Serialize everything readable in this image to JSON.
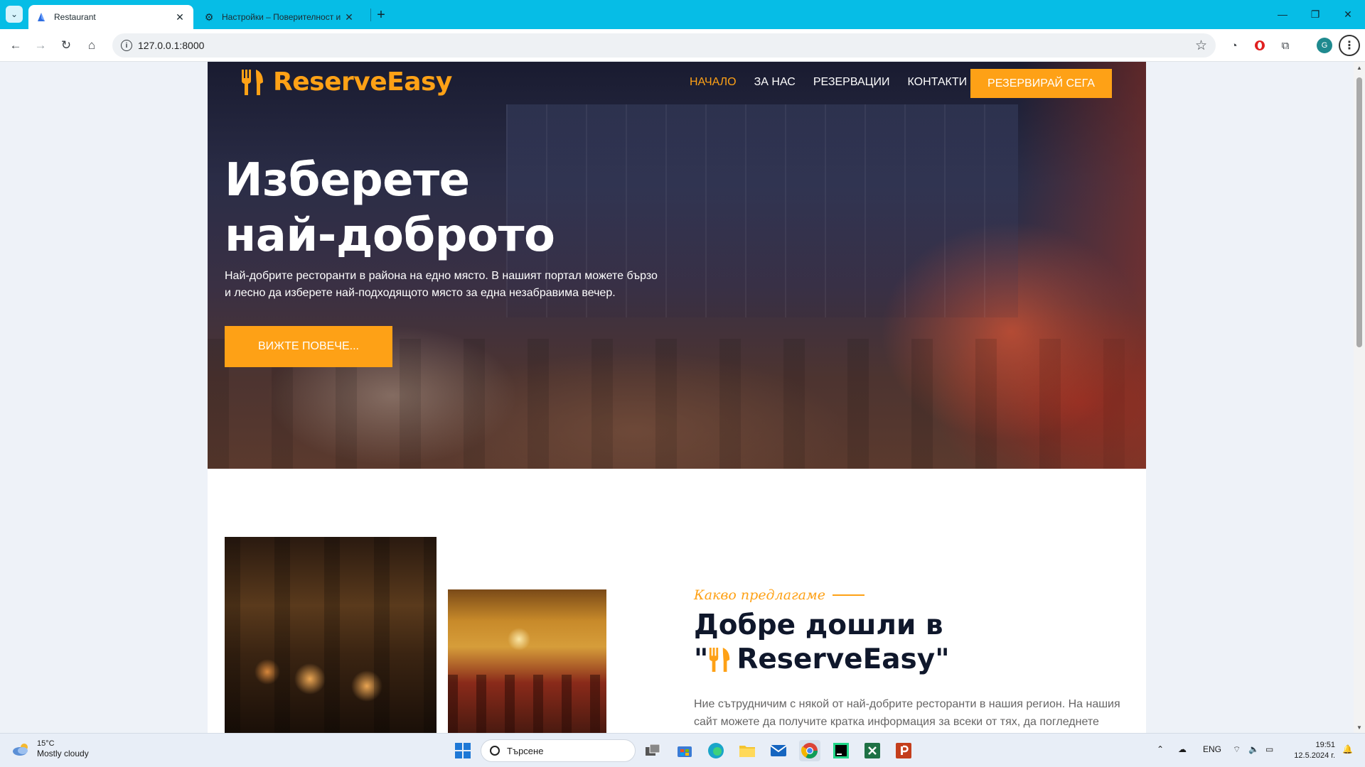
{
  "browser": {
    "tabs": [
      {
        "title": "Restaurant",
        "active": true
      },
      {
        "title": "Настройки – Поверителност и",
        "active": false
      }
    ],
    "url": "127.0.0.1:8000"
  },
  "site": {
    "brand": "ReserveEasy",
    "nav": {
      "home": "НАЧАЛО",
      "about": "ЗА НАС",
      "reservations": "РЕЗЕРВАЦИИ",
      "contacts": "КОНТАКТИ",
      "cta": "РЕЗЕРВИРАЙ СЕГА"
    },
    "hero": {
      "title_line1": "Изберете",
      "title_line2": "най-доброто",
      "text": "Най-добрите ресторанти в района на едно място. В нашият портал можете бързо и лесно да изберете най-подходящото място за една незабравима вечер.",
      "button": "ВИЖТЕ ПОВЕЧЕ..."
    },
    "about": {
      "kicker": "Какво предлагаме",
      "title_line1": "Добре дошли в",
      "title_quote_open": "\"",
      "title_brand": "ReserveEasy",
      "title_quote_close": "\"",
      "text": "Ние сътрудничим с някой от най-добрите ресторанти в нашия регион. На нашия сайт можете да получите кратка информация за всеки от тях, да погледнете"
    },
    "accent_color": "#fea116"
  },
  "taskbar": {
    "weather_temp": "15°C",
    "weather_desc": "Mostly cloudy",
    "search_placeholder": "Търсене",
    "lang": "ENG",
    "time": "19:51",
    "date": "12.5.2024 г."
  }
}
